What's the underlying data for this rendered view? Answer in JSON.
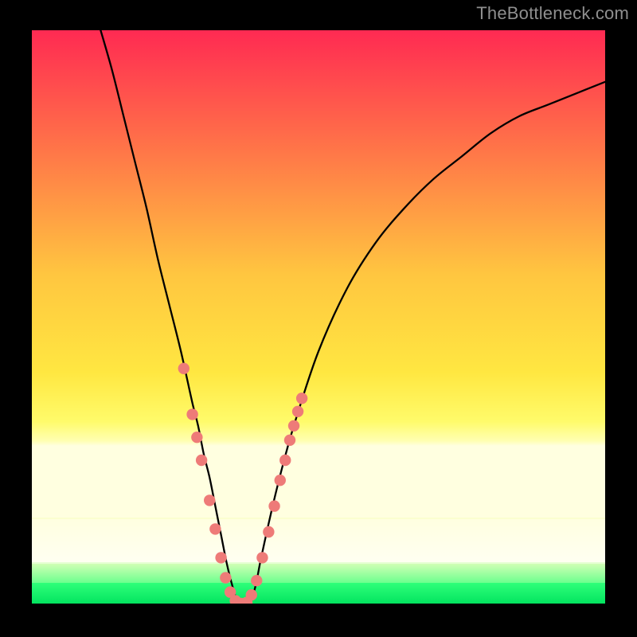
{
  "watermark": "TheBottleneck.com",
  "colors": {
    "frame": "#000000",
    "gradient_top": "#ff2a52",
    "gradient_mid_orange": "#ffa143",
    "gradient_yellow": "#ffe641",
    "gradient_pale_yellow": "#ffff98",
    "gradient_bottom_green": "#16ff74",
    "curve": "#000000",
    "marker": "#ee7b78",
    "watermark_color": "#8f8f8f"
  },
  "chart_data": {
    "type": "line",
    "title": "",
    "xlabel": "",
    "ylabel": "",
    "xlim": [
      0,
      100
    ],
    "ylim": [
      0,
      100
    ],
    "grid": false,
    "legend": false,
    "series": [
      {
        "name": "bottleneck-curve",
        "x": [
          12,
          14,
          16,
          18,
          20,
          22,
          24,
          26,
          28,
          29,
          30,
          31,
          32,
          33,
          34,
          35,
          36,
          37,
          38,
          39,
          40,
          42,
          44,
          46,
          50,
          55,
          60,
          65,
          70,
          75,
          80,
          85,
          90,
          95,
          100
        ],
        "y": [
          100,
          93,
          85,
          77,
          69,
          60,
          52,
          44,
          35,
          31,
          26,
          22,
          17,
          12,
          7,
          3,
          0,
          0,
          0,
          3,
          8,
          17,
          25,
          32,
          44,
          55,
          63,
          69,
          74,
          78,
          82,
          85,
          87,
          89,
          91
        ]
      }
    ],
    "markers": {
      "name": "highlighted-points",
      "points": [
        {
          "x": 26.5,
          "y": 41
        },
        {
          "x": 28,
          "y": 33
        },
        {
          "x": 28.8,
          "y": 29
        },
        {
          "x": 29.6,
          "y": 25
        },
        {
          "x": 31,
          "y": 18
        },
        {
          "x": 32,
          "y": 13
        },
        {
          "x": 33,
          "y": 8
        },
        {
          "x": 33.8,
          "y": 4.5
        },
        {
          "x": 34.6,
          "y": 2
        },
        {
          "x": 35.5,
          "y": 0.5
        },
        {
          "x": 36.5,
          "y": 0
        },
        {
          "x": 37.5,
          "y": 0.2
        },
        {
          "x": 38.3,
          "y": 1.5
        },
        {
          "x": 39.2,
          "y": 4
        },
        {
          "x": 40.2,
          "y": 8
        },
        {
          "x": 41.3,
          "y": 12.5
        },
        {
          "x": 42.3,
          "y": 17
        },
        {
          "x": 43.3,
          "y": 21.5
        },
        {
          "x": 44.2,
          "y": 25
        },
        {
          "x": 45,
          "y": 28.5
        },
        {
          "x": 45.7,
          "y": 31
        },
        {
          "x": 46.4,
          "y": 33.5
        },
        {
          "x": 47.1,
          "y": 35.8
        }
      ]
    }
  }
}
